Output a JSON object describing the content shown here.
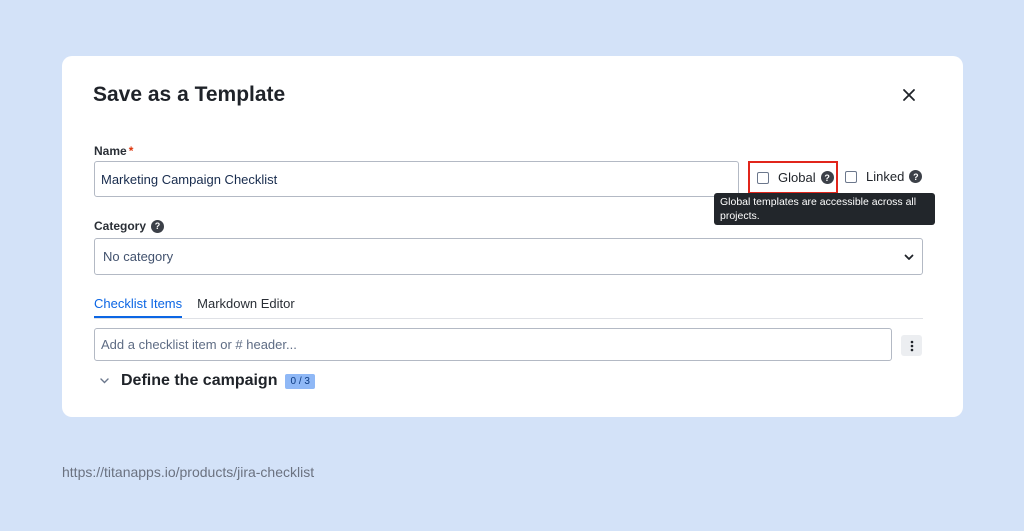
{
  "dialog": {
    "title": "Save as a Template",
    "name_label": "Name",
    "required_mark": "*",
    "name_value": "Marketing Campaign Checklist",
    "global_label": "Global",
    "linked_label": "Linked",
    "tooltip": "Global templates are accessible across all projects.",
    "category_label": "Category",
    "category_value": "No category",
    "tabs": [
      {
        "label": "Checklist Items",
        "active": true
      },
      {
        "label": "Markdown Editor",
        "active": false
      }
    ],
    "add_placeholder": "Add a checklist item or # header...",
    "section": {
      "title": "Define the campaign",
      "badge": "0 / 3"
    }
  },
  "footer_url": "https://titanapps.io/products/jira-checklist",
  "colors": {
    "background": "#d3e2f8",
    "accent": "#0c66e4",
    "highlight": "#e1251b"
  }
}
